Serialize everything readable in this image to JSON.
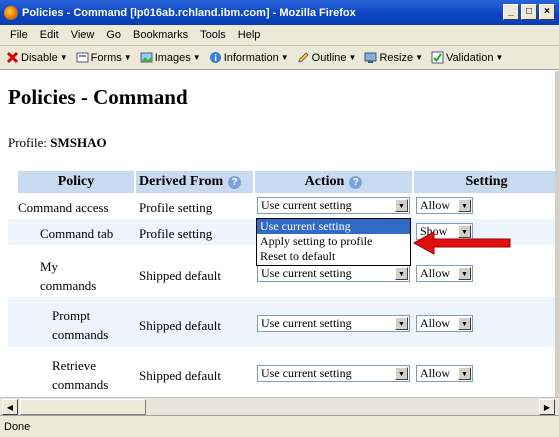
{
  "window": {
    "title": "Policies - Command [lp016ab.rchland.ibm.com] - Mozilla Firefox"
  },
  "menu": [
    "File",
    "Edit",
    "View",
    "Go",
    "Bookmarks",
    "Tools",
    "Help"
  ],
  "toolbar": [
    "Disable",
    "Forms",
    "Images",
    "Information",
    "Outline",
    "Resize",
    "Validation"
  ],
  "page": {
    "heading": "Policies - Command",
    "profile_label": "Profile:",
    "profile_value": "SMSHAO"
  },
  "table": {
    "headers": [
      "Policy",
      "Derived From",
      "Action",
      "Setting"
    ],
    "rows": [
      {
        "policy": "Command access",
        "derived": "Profile setting",
        "action": "Use current setting",
        "setting": "Allow"
      },
      {
        "policy": "Command tab",
        "derived": "Profile setting",
        "action": "",
        "setting": "Show"
      },
      {
        "policy": "My commands",
        "derived": "Shipped default",
        "action": "Use current setting",
        "setting": "Allow"
      },
      {
        "policy": "Prompt commands",
        "derived": "Shipped default",
        "action": "Use current setting",
        "setting": "Allow"
      },
      {
        "policy": "Retrieve commands",
        "derived": "Shipped default",
        "action": "Use current setting",
        "setting": "Allow"
      }
    ]
  },
  "dropdown_options": [
    "Use current setting",
    "Apply setting to profile",
    "Reset to default"
  ],
  "status": "Done",
  "colors": {
    "header_bg": "#c8daf0",
    "row_alt_bg": "#eef4fb",
    "highlight": "#316ac5",
    "arrow": "#e01010"
  }
}
